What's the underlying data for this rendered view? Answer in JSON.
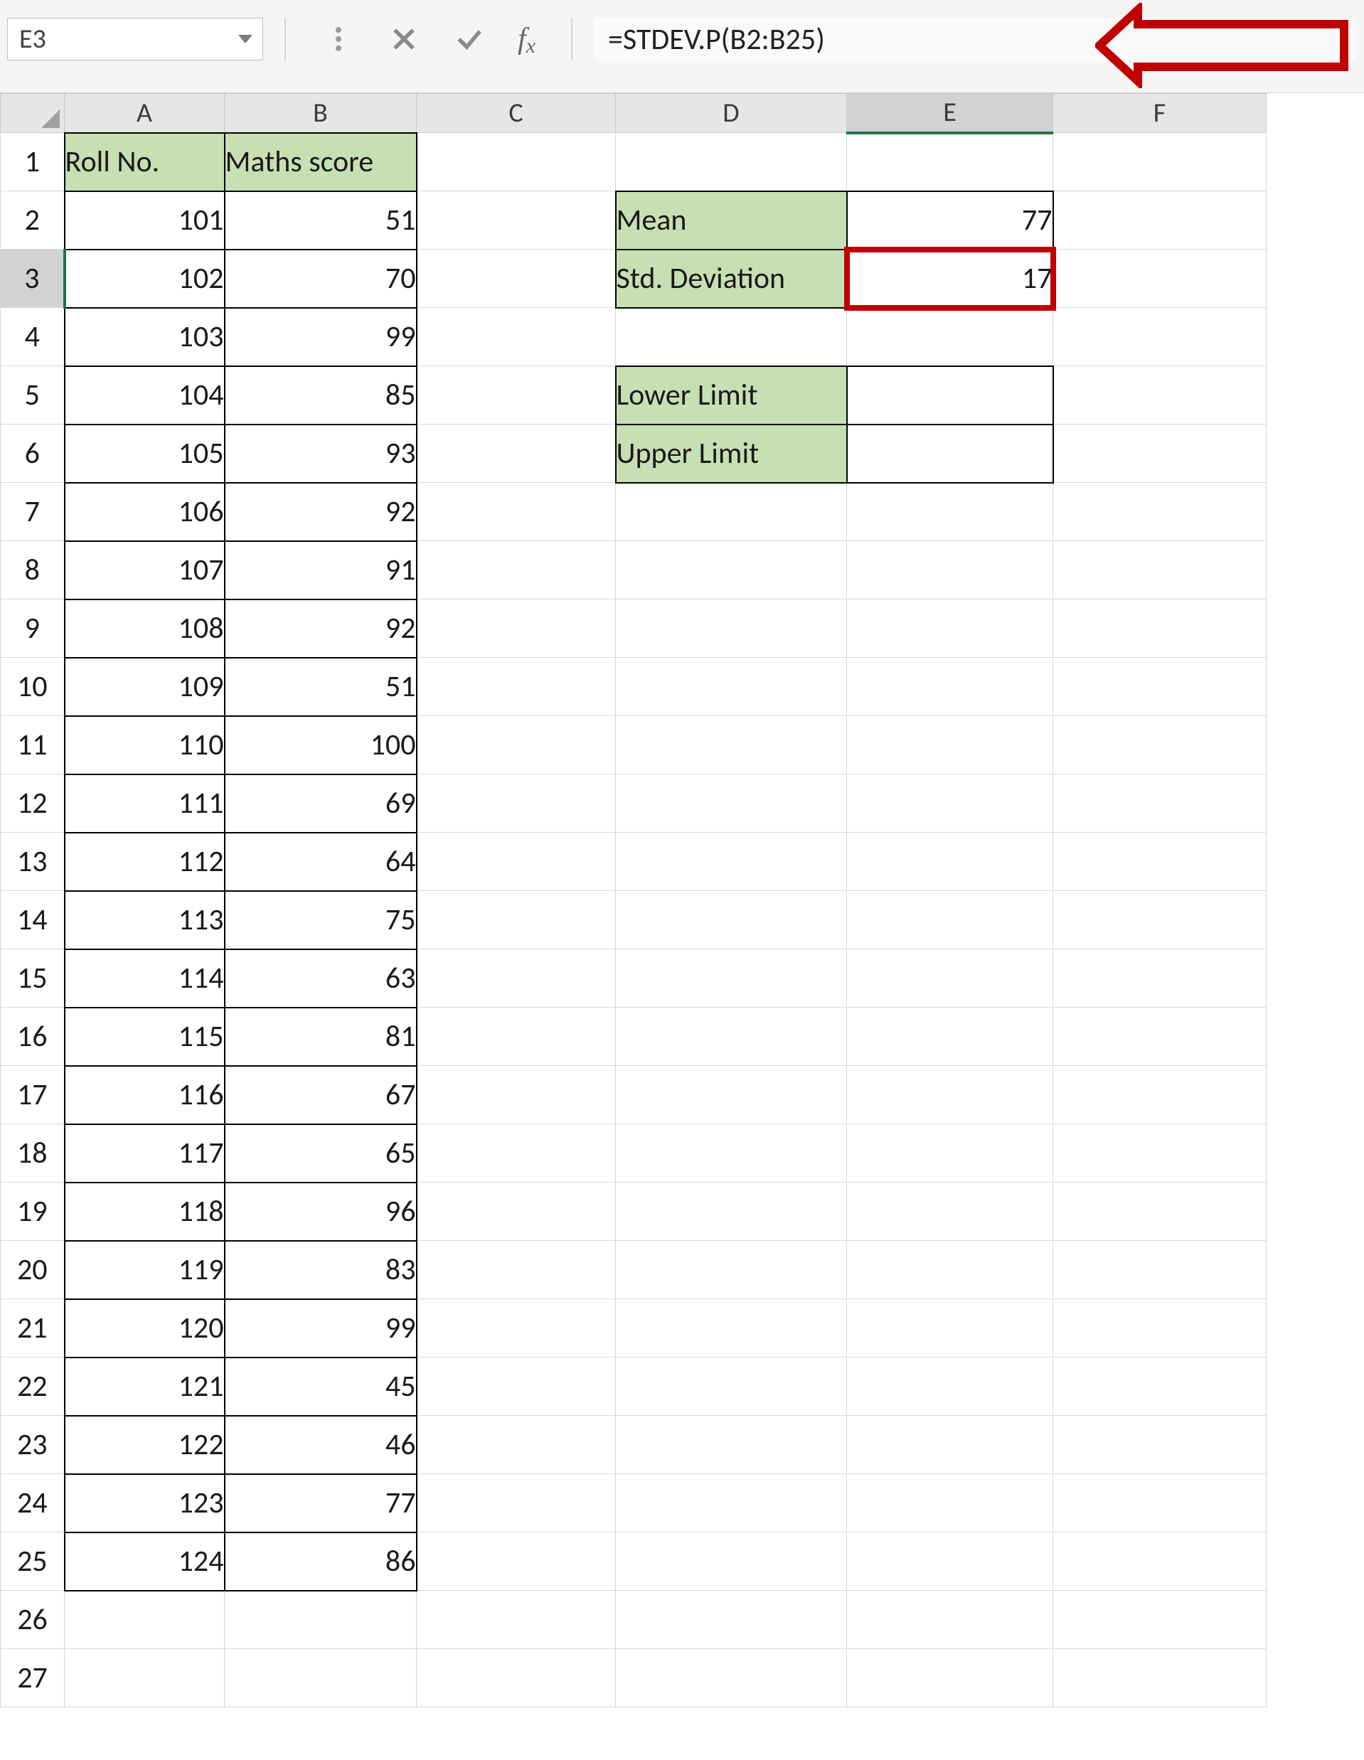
{
  "formula_bar": {
    "cell_ref": "E3",
    "formula": "=STDEV.P(B2:B25)"
  },
  "columns": [
    "A",
    "B",
    "C",
    "D",
    "E",
    "F"
  ],
  "row_count": 27,
  "headers": {
    "A": "Roll No.",
    "B": "Maths score"
  },
  "data_rows": [
    {
      "roll": "101",
      "score": "51"
    },
    {
      "roll": "102",
      "score": "70"
    },
    {
      "roll": "103",
      "score": "99"
    },
    {
      "roll": "104",
      "score": "85"
    },
    {
      "roll": "105",
      "score": "93"
    },
    {
      "roll": "106",
      "score": "92"
    },
    {
      "roll": "107",
      "score": "91"
    },
    {
      "roll": "108",
      "score": "92"
    },
    {
      "roll": "109",
      "score": "51"
    },
    {
      "roll": "110",
      "score": "100"
    },
    {
      "roll": "111",
      "score": "69"
    },
    {
      "roll": "112",
      "score": "64"
    },
    {
      "roll": "113",
      "score": "75"
    },
    {
      "roll": "114",
      "score": "63"
    },
    {
      "roll": "115",
      "score": "81"
    },
    {
      "roll": "116",
      "score": "67"
    },
    {
      "roll": "117",
      "score": "65"
    },
    {
      "roll": "118",
      "score": "96"
    },
    {
      "roll": "119",
      "score": "83"
    },
    {
      "roll": "120",
      "score": "99"
    },
    {
      "roll": "121",
      "score": "45"
    },
    {
      "roll": "122",
      "score": "46"
    },
    {
      "roll": "123",
      "score": "77"
    },
    {
      "roll": "124",
      "score": "86"
    }
  ],
  "summary": {
    "mean_label": "Mean",
    "mean_value": "77",
    "std_label": "Std. Deviation",
    "std_value": "17",
    "lower_label": "Lower Limit",
    "lower_value": "",
    "upper_label": "Upper Limit",
    "upper_value": ""
  },
  "active_cell": "E3"
}
